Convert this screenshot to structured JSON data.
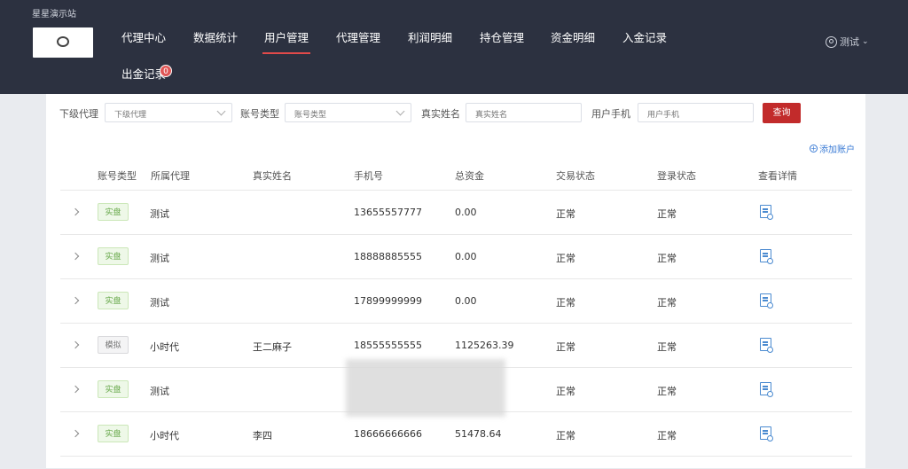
{
  "site_title": "星星演示站",
  "nav": {
    "items": [
      "代理中心",
      "数据统计",
      "用户管理",
      "代理管理",
      "利润明细",
      "持仓管理",
      "资金明细",
      "入金记录",
      "出金记录"
    ],
    "active": "用户管理",
    "badge": "0"
  },
  "user_menu": {
    "label": "测试"
  },
  "filters": {
    "upper_agent": {
      "label": "下级代理",
      "placeholder": "下级代理"
    },
    "account_type": {
      "label": "账号类型",
      "placeholder": "账号类型"
    },
    "real_name": {
      "label": "真实姓名",
      "placeholder": "真实姓名"
    },
    "phone": {
      "label": "用户手机",
      "placeholder": "用户手机"
    },
    "search_label": "查询"
  },
  "add_account_label": "添加账户",
  "table": {
    "columns": [
      "账号类型",
      "所属代理",
      "真实姓名",
      "手机号",
      "总资金",
      "交易状态",
      "登录状态",
      "查看详情"
    ],
    "rows": [
      {
        "type": "实盘",
        "agent": "测试",
        "name": "",
        "phone": "13655557777",
        "funds": "0.00",
        "trade": "正常",
        "login": "正常"
      },
      {
        "type": "实盘",
        "agent": "测试",
        "name": "",
        "phone": "18888885555",
        "funds": "0.00",
        "trade": "正常",
        "login": "正常"
      },
      {
        "type": "实盘",
        "agent": "测试",
        "name": "",
        "phone": "17899999999",
        "funds": "0.00",
        "trade": "正常",
        "login": "正常"
      },
      {
        "type": "模拟",
        "agent": "小时代",
        "name": "王二麻子",
        "phone": "18555555555",
        "funds": "1125263.39",
        "trade": "正常",
        "login": "正常"
      },
      {
        "type": "实盘",
        "agent": "测试",
        "name": "",
        "phone": "",
        "funds": "",
        "trade": "正常",
        "login": "正常"
      },
      {
        "type": "实盘",
        "agent": "小时代",
        "name": "李四",
        "phone": "18666666666",
        "funds": "51478.64",
        "trade": "正常",
        "login": "正常"
      }
    ]
  },
  "colors": {
    "header_bg": "#2c3140",
    "accent": "#c22b2b",
    "link": "#3a7bd5"
  }
}
